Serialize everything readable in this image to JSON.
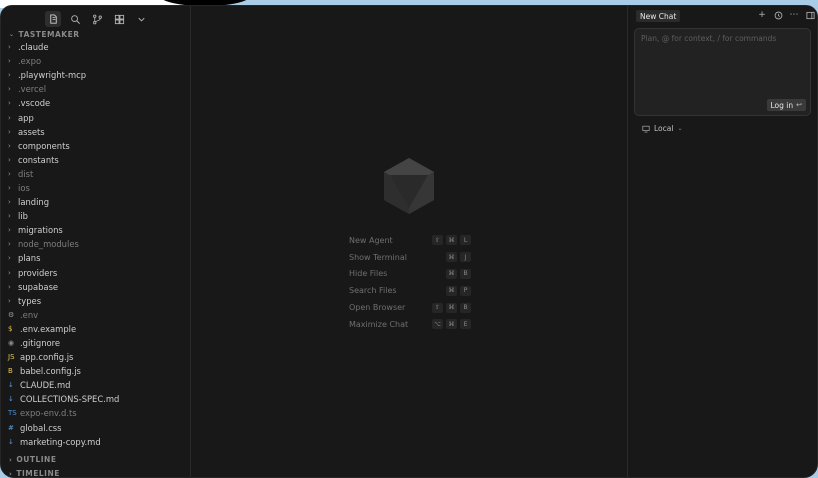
{
  "sidebar": {
    "project_title": "TASTEMAKER",
    "items": [
      {
        "label": ".claude",
        "kind": "folder",
        "dim": false
      },
      {
        "label": ".expo",
        "kind": "folder",
        "dim": true
      },
      {
        "label": ".playwright-mcp",
        "kind": "folder",
        "dim": false
      },
      {
        "label": ".vercel",
        "kind": "folder",
        "dim": true
      },
      {
        "label": ".vscode",
        "kind": "folder",
        "dim": false
      },
      {
        "label": "app",
        "kind": "folder",
        "dim": false
      },
      {
        "label": "assets",
        "kind": "folder",
        "dim": false
      },
      {
        "label": "components",
        "kind": "folder",
        "dim": false
      },
      {
        "label": "constants",
        "kind": "folder",
        "dim": false
      },
      {
        "label": "dist",
        "kind": "folder",
        "dim": true
      },
      {
        "label": "ios",
        "kind": "folder",
        "dim": true
      },
      {
        "label": "landing",
        "kind": "folder",
        "dim": false
      },
      {
        "label": "lib",
        "kind": "folder",
        "dim": false
      },
      {
        "label": "migrations",
        "kind": "folder",
        "dim": false
      },
      {
        "label": "node_modules",
        "kind": "folder",
        "dim": true
      },
      {
        "label": "plans",
        "kind": "folder",
        "dim": false
      },
      {
        "label": "providers",
        "kind": "folder",
        "dim": false
      },
      {
        "label": "supabase",
        "kind": "folder",
        "dim": false
      },
      {
        "label": "types",
        "kind": "folder",
        "dim": false
      },
      {
        "label": ".env",
        "kind": "gear-file",
        "dim": true
      },
      {
        "label": ".env.example",
        "kind": "dollar-file",
        "dim": false
      },
      {
        "label": ".gitignore",
        "kind": "git-file",
        "dim": false
      },
      {
        "label": "app.config.js",
        "kind": "js-file",
        "dim": false
      },
      {
        "label": "babel.config.js",
        "kind": "babel-file",
        "dim": false
      },
      {
        "label": "CLAUDE.md",
        "kind": "md-file",
        "dim": false
      },
      {
        "label": "COLLECTIONS-SPEC.md",
        "kind": "md-file",
        "dim": false
      },
      {
        "label": "expo-env.d.ts",
        "kind": "ts-file",
        "dim": true
      },
      {
        "label": "global.css",
        "kind": "css-file",
        "dim": false
      },
      {
        "label": "marketing-copy.md",
        "kind": "md-file",
        "dim": false
      }
    ],
    "outline_label": "OUTLINE",
    "timeline_label": "TIMELINE"
  },
  "icons": {
    "js-file": {
      "glyph": "JS",
      "color": "#e6c74c"
    },
    "ts-file": {
      "glyph": "TS",
      "color": "#4f8fd6"
    },
    "md-file": {
      "glyph": "↓",
      "color": "#5a9fe0"
    },
    "css-file": {
      "glyph": "#",
      "color": "#5aa0d8"
    },
    "gear-file": {
      "glyph": "⚙",
      "color": "#9a9a9a"
    },
    "dollar-file": {
      "glyph": "$",
      "color": "#e0c34a"
    },
    "git-file": {
      "glyph": "◉",
      "color": "#8a8a8a"
    },
    "babel-file": {
      "glyph": "B",
      "color": "#e6c74c"
    }
  },
  "shortcuts": [
    {
      "label": "New Agent",
      "keys": [
        "⇧",
        "⌘",
        "L"
      ]
    },
    {
      "label": "Show Terminal",
      "keys": [
        "⌘",
        "J"
      ]
    },
    {
      "label": "Hide Files",
      "keys": [
        "⌘",
        "B"
      ]
    },
    {
      "label": "Search Files",
      "keys": [
        "⌘",
        "P"
      ]
    },
    {
      "label": "Open Browser",
      "keys": [
        "⇧",
        "⌘",
        "B"
      ]
    },
    {
      "label": "Maximize Chat",
      "keys": [
        "⌥",
        "⌘",
        "E"
      ]
    }
  ],
  "chat": {
    "tab_label": "New Chat",
    "input_placeholder": "Plan, @ for context, / for commands",
    "login_label": "Log in",
    "env_label": "Local"
  }
}
